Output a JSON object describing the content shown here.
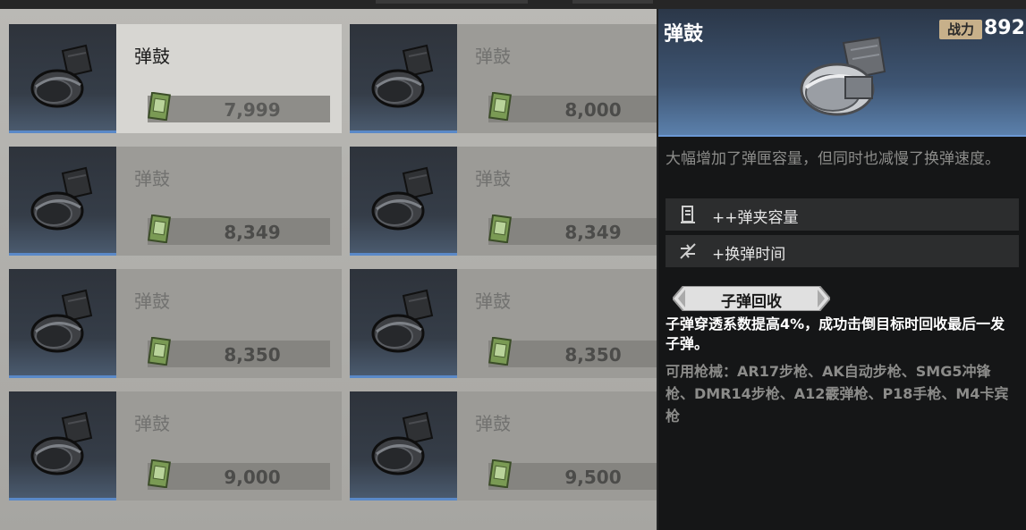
{
  "items": [
    {
      "name": "弹鼓",
      "price": "7,999",
      "selected": true
    },
    {
      "name": "弹鼓",
      "price": "8,000",
      "selected": false
    },
    {
      "name": "弹鼓",
      "price": "8,349",
      "selected": false
    },
    {
      "name": "弹鼓",
      "price": "8,349",
      "selected": false
    },
    {
      "name": "弹鼓",
      "price": "8,350",
      "selected": false
    },
    {
      "name": "弹鼓",
      "price": "8,350",
      "selected": false
    },
    {
      "name": "弹鼓",
      "price": "9,000",
      "selected": false
    },
    {
      "name": "弹鼓",
      "price": "9,500",
      "selected": false
    }
  ],
  "detail": {
    "title": "弹鼓",
    "power_label": "战力",
    "power_value": "892",
    "description": "大幅增加了弹匣容量，但同时也减慢了换弹速度。",
    "stats": [
      {
        "label": "++弹夹容量",
        "icon": "magazine-icon"
      },
      {
        "label": "+换弹时间",
        "icon": "reload-icon"
      }
    ],
    "skill_name": "子弹回收",
    "skill_description": "子弹穿透系数提高4%，成功击倒目标时回收最后一发子弹。",
    "weapons_text": "可用枪械：AR17步枪、AK自动步枪、SMG5冲锋枪、DMR14步枪、A12霰弹枪、P18手枪、M4卡宾枪"
  },
  "colors": {
    "accent_blue": "#5a89c8",
    "power_badge": "#c7b08a",
    "skill_tag": "#dcdcdc"
  }
}
